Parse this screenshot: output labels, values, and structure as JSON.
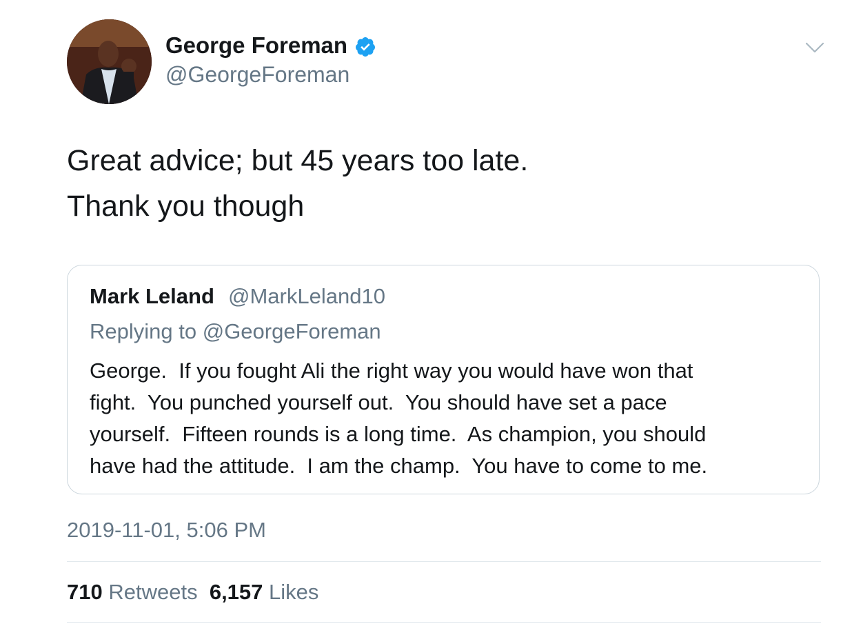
{
  "author": {
    "display_name": "George Foreman",
    "handle": "@GeorgeForeman",
    "verified": true,
    "verified_color": "#1da1f2"
  },
  "tweet": {
    "lines": [
      "Great advice; but 45 years too late.",
      "Thank you though"
    ],
    "timestamp": "2019-11-01, 5:06 PM"
  },
  "quoted": {
    "display_name": "Mark Leland",
    "handle": "@MarkLeland10",
    "replying_prefix": "Replying to",
    "replying_to": "@GeorgeForeman",
    "lines": [
      "George.  If you fought Ali the right way you would have won that",
      "fight.  You punched yourself out.  You should have set a pace",
      "yourself.  Fifteen rounds is a long time.  As champion, you should",
      "have had the attitude.  I am the champ.  You have to come to me."
    ]
  },
  "stats": {
    "retweets_count": "710",
    "retweets_label": "Retweets",
    "likes_count": "6,157",
    "likes_label": "Likes"
  },
  "icons": {
    "verified": "verified-badge-icon",
    "menu": "chevron-down-icon"
  },
  "colors": {
    "text": "#14171a",
    "secondary": "#657786",
    "border": "#ccd6dd"
  }
}
